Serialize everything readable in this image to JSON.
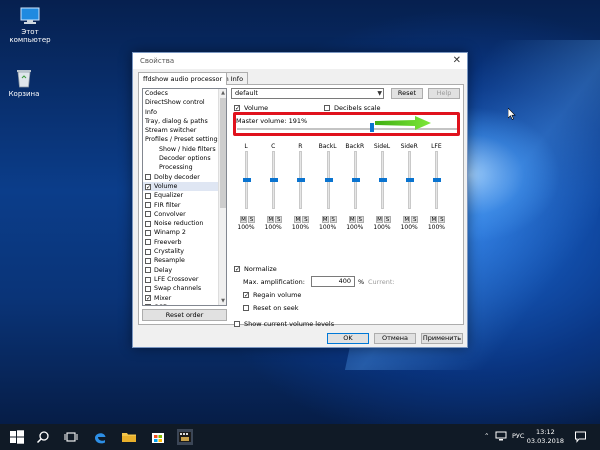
{
  "desktop": {
    "icons": [
      {
        "label": "Этот компьютер"
      },
      {
        "label": "Корзина"
      }
    ]
  },
  "dialog": {
    "title": "Свойства",
    "tabs": [
      "ffdshow audio processor",
      "Pin Info"
    ],
    "filter_list": [
      {
        "label": "Codecs",
        "kind": "plain"
      },
      {
        "label": "DirectShow control",
        "kind": "plain"
      },
      {
        "label": "Info",
        "kind": "plain"
      },
      {
        "label": "Tray, dialog & paths",
        "kind": "plain"
      },
      {
        "label": "Stream switcher",
        "kind": "plain"
      },
      {
        "label": "Profiles / Preset settings",
        "kind": "plain"
      },
      {
        "label": "Show / hide filters",
        "kind": "sub"
      },
      {
        "label": "Decoder options",
        "kind": "sub"
      },
      {
        "label": "Processing",
        "kind": "sub"
      },
      {
        "label": "Dolby decoder",
        "kind": "check",
        "checked": false
      },
      {
        "label": "Volume",
        "kind": "check",
        "checked": true,
        "selected": true
      },
      {
        "label": "Equalizer",
        "kind": "check",
        "checked": false
      },
      {
        "label": "FIR filter",
        "kind": "check",
        "checked": false
      },
      {
        "label": "Convolver",
        "kind": "check",
        "checked": false
      },
      {
        "label": "Noise reduction",
        "kind": "check",
        "checked": false
      },
      {
        "label": "Winamp 2",
        "kind": "check",
        "checked": false
      },
      {
        "label": "Freeverb",
        "kind": "check",
        "checked": false
      },
      {
        "label": "Crystality",
        "kind": "check",
        "checked": false
      },
      {
        "label": "Resample",
        "kind": "check",
        "checked": false
      },
      {
        "label": "Delay",
        "kind": "check",
        "checked": false
      },
      {
        "label": "LFE Crossover",
        "kind": "check",
        "checked": false
      },
      {
        "label": "Swap channels",
        "kind": "check",
        "checked": false
      },
      {
        "label": "Mixer",
        "kind": "check",
        "checked": true
      },
      {
        "label": "OSD",
        "kind": "check",
        "checked": false
      }
    ],
    "reset_order_label": "Reset order",
    "preset_value": "default",
    "reset_label": "Reset",
    "help_label": "Help",
    "volume_check": {
      "label": "Volume",
      "checked": true
    },
    "decibels_check": {
      "label": "Decibels scale",
      "checked": false
    },
    "master_volume": {
      "label": "Master volume: 191%",
      "level": 0.61
    },
    "channels": [
      {
        "label": "L",
        "value": "100%",
        "level": 0.5
      },
      {
        "label": "C",
        "value": "100%",
        "level": 0.5
      },
      {
        "label": "R",
        "value": "100%",
        "level": 0.5
      },
      {
        "label": "BackL",
        "value": "100%",
        "level": 0.5
      },
      {
        "label": "BackR",
        "value": "100%",
        "level": 0.5
      },
      {
        "label": "SideL",
        "value": "100%",
        "level": 0.5
      },
      {
        "label": "SideR",
        "value": "100%",
        "level": 0.5
      },
      {
        "label": "LFE",
        "value": "100%",
        "level": 0.5
      }
    ],
    "mute_label": "M",
    "solo_label": "S",
    "normalize": {
      "label": "Normalize",
      "checked": true
    },
    "max_amp": {
      "label": "Max. amplification:",
      "value": "400",
      "unit": "%",
      "current_label": "Current:"
    },
    "regain": {
      "label": "Regain volume",
      "checked": true
    },
    "reset_on_seek": {
      "label": "Reset on seek",
      "checked": false
    },
    "show_levels": {
      "label": "Show current volume levels",
      "checked": false
    },
    "ok_label": "OK",
    "cancel_label": "Отмена",
    "apply_label": "Применить"
  },
  "taskbar": {
    "language": "РУС",
    "time": "13:12",
    "date": "03.03.2018"
  },
  "colors": {
    "accent": "#0a74d0",
    "highlight_border": "#e0121d",
    "arrow_green": "#5fd016"
  }
}
